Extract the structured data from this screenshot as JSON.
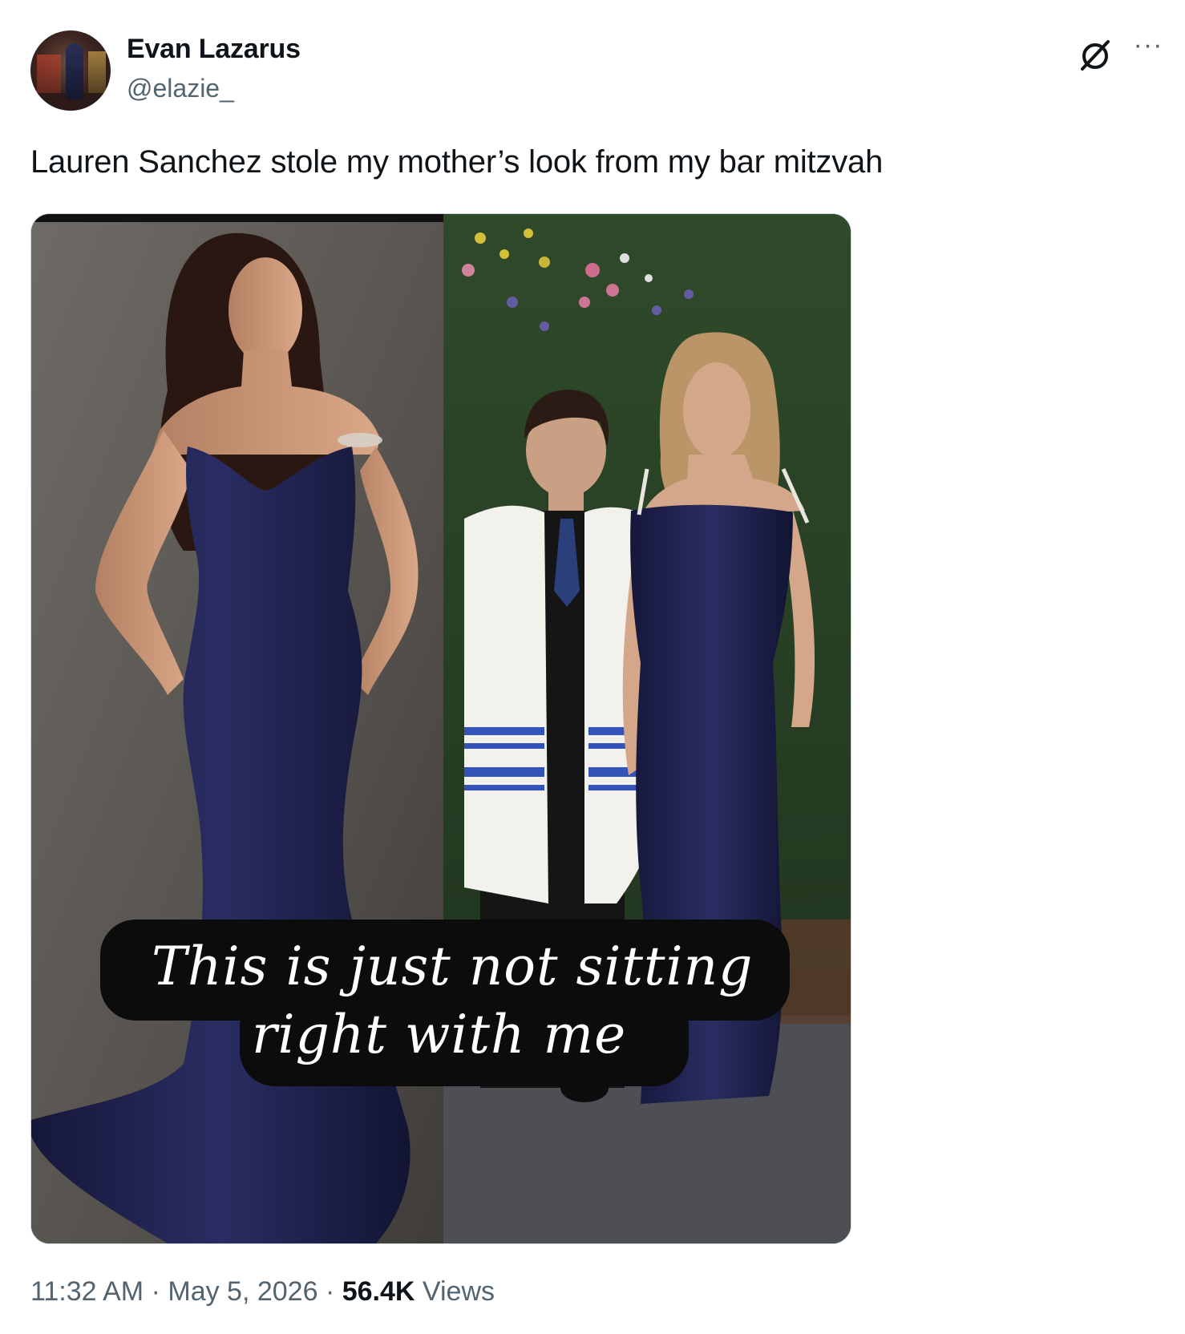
{
  "author": {
    "name": "Evan Lazarus",
    "handle": "@elazie_"
  },
  "actions": {
    "grok_icon": "grok-icon",
    "more_label": "···"
  },
  "post": {
    "text": "Lauren Sanchez stole my mother’s look from my bar mitzvah"
  },
  "media": {
    "caption_line_1": "This is just not sitting",
    "caption_line_2": "right with me"
  },
  "meta": {
    "time": "11:32 AM",
    "separator_1": "·",
    "date": "May 5, 2026",
    "separator_2": "·",
    "views_count": "56.4K",
    "views_label": "Views"
  },
  "colors": {
    "text_primary": "#0f1419",
    "text_secondary": "#536471",
    "gown": "#1b1d45"
  }
}
